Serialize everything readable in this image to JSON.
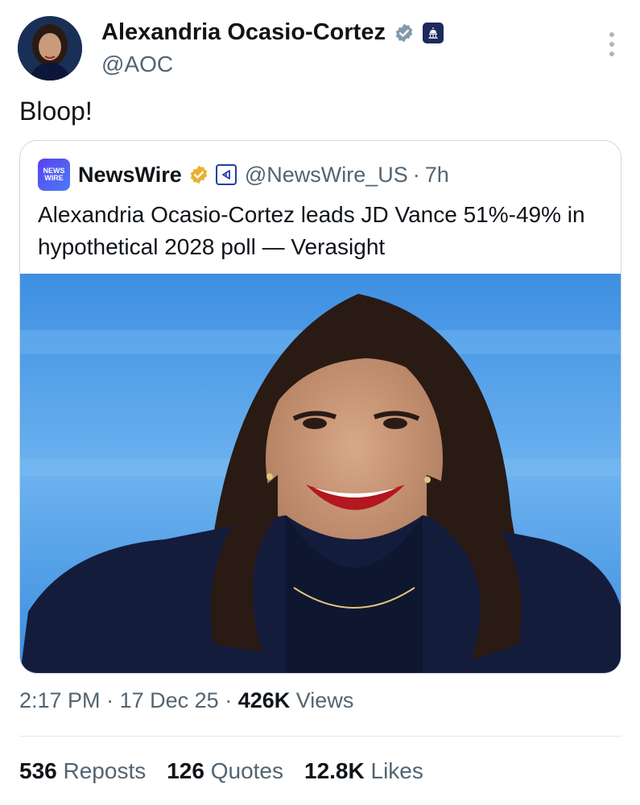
{
  "author": {
    "name": "Alexandria Ocasio-Cortez",
    "handle": "@AOC",
    "verified_color": "#829aab"
  },
  "post": {
    "text": "Bloop!"
  },
  "quoted": {
    "logo_line1": "NEWS",
    "logo_line2": "WIRE",
    "name": "NewsWire",
    "handle": "@NewsWire_US",
    "separator": "·",
    "time": "7h",
    "text": "Alexandria Ocasio-Cortez leads JD Vance 51%-49% in hypothetical 2028 poll — Verasight",
    "verified_color": "#e8b130"
  },
  "meta": {
    "time": "2:17 PM",
    "sep1": "·",
    "date": "17 Dec 25",
    "sep2": "·",
    "views_count": "426K",
    "views_label": "Views"
  },
  "stats": {
    "reposts_count": "536",
    "reposts_label": "Reposts",
    "quotes_count": "126",
    "quotes_label": "Quotes",
    "likes_count": "12.8K",
    "likes_label": "Likes"
  },
  "colors": {
    "text_primary": "#0f1419",
    "text_secondary": "#536471",
    "border": "#cfd9de"
  }
}
